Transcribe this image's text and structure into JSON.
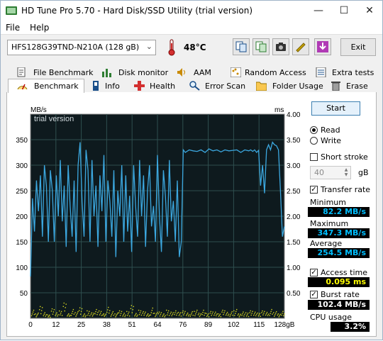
{
  "window": {
    "title": "HD Tune Pro 5.70 - Hard Disk/SSD Utility (trial version)"
  },
  "menu": {
    "file": "File",
    "help": "Help"
  },
  "toolbar": {
    "drive": "HFS128G39TND-N210A (128 gB)",
    "temperature": "48°C",
    "exit_label": "Exit"
  },
  "tabs_top": [
    "File Benchmark",
    "Disk monitor",
    "AAM",
    "Random Access",
    "Extra tests"
  ],
  "tabs_bottom": [
    "Benchmark",
    "Info",
    "Health",
    "Error Scan",
    "Folder Usage",
    "Erase"
  ],
  "active_tab": "Benchmark",
  "controls": {
    "start_label": "Start",
    "read_label": "Read",
    "write_label": "Write",
    "mode": "Read",
    "short_stroke_label": "Short stroke",
    "short_stroke_checked": false,
    "short_stroke_value": "40",
    "short_stroke_unit": "gB",
    "transfer_rate_label": "Transfer rate",
    "transfer_rate_checked": true,
    "access_time_label": "Access time",
    "access_time_checked": true,
    "burst_rate_label": "Burst rate",
    "burst_rate_checked": true
  },
  "stats": {
    "minimum_label": "Minimum",
    "minimum": "82.2 MB/s",
    "maximum_label": "Maximum",
    "maximum": "347.3 MB/s",
    "average_label": "Average",
    "average": "254.5 MB/s",
    "access_time": "0.095 ms",
    "burst_rate": "102.4 MB/s",
    "cpu_label": "CPU usage",
    "cpu": "3.2%"
  },
  "colors": {
    "plot_bg": "#0e1a1e",
    "grid": "#2f4f4f",
    "transfer_line": "#3ca8e0",
    "access_dots": "#d8d820"
  },
  "chart_data": {
    "type": "line",
    "watermark": "trial version",
    "ylabel_left": "MB/s",
    "ylabel_right": "ms",
    "xlabel": "gB",
    "xlim": [
      0,
      128
    ],
    "ylim_left": [
      0,
      400
    ],
    "ylim_right": [
      0,
      4.0
    ],
    "x_ticks": [
      "0",
      "12",
      "25",
      "38",
      "51",
      "64",
      "76",
      "89",
      "102",
      "115",
      "128gB"
    ],
    "y_ticks_left": [
      "50",
      "100",
      "150",
      "200",
      "250",
      "300",
      "350"
    ],
    "y_ticks_right": [
      "0.50",
      "1.00",
      "1.50",
      "2.00",
      "2.50",
      "3.00",
      "3.50",
      "4.00"
    ],
    "grid": true,
    "series": [
      {
        "name": "Transfer rate",
        "x": [
          0,
          1,
          2,
          3,
          4,
          5,
          6,
          7,
          8,
          9,
          10,
          11,
          12,
          13,
          14,
          15,
          16,
          17,
          18,
          19,
          20,
          21,
          22,
          23,
          24,
          25,
          26,
          27,
          28,
          29,
          30,
          31,
          32,
          33,
          34,
          35,
          36,
          37,
          38,
          39,
          40,
          41,
          42,
          43,
          44,
          45,
          46,
          47,
          48,
          49,
          50,
          51,
          52,
          53,
          54,
          55,
          56,
          57,
          58,
          59,
          60,
          61,
          62,
          63,
          64,
          65,
          66,
          67,
          68,
          69,
          70,
          71,
          72,
          73,
          74,
          75,
          76,
          77,
          78,
          80,
          82,
          84,
          86,
          88,
          90,
          92,
          94,
          96,
          98,
          100,
          102,
          104,
          106,
          108,
          110,
          111,
          112,
          113,
          114,
          115,
          116,
          117,
          118,
          119,
          120,
          121,
          122,
          123,
          124,
          125,
          126,
          127,
          128
        ],
        "values": [
          82,
          235,
          170,
          270,
          210,
          280,
          160,
          300,
          260,
          150,
          290,
          250,
          150,
          280,
          200,
          310,
          190,
          260,
          140,
          300,
          220,
          160,
          270,
          130,
          300,
          345,
          230,
          160,
          330,
          290,
          150,
          310,
          200,
          260,
          140,
          280,
          210,
          320,
          150,
          270,
          230,
          160,
          290,
          120,
          250,
          200,
          300,
          150,
          280,
          170,
          240,
          130,
          300,
          220,
          160,
          310,
          200,
          280,
          140,
          250,
          300,
          180,
          220,
          150,
          320,
          200,
          130,
          290,
          240,
          160,
          310,
          190,
          230,
          150,
          270,
          120,
          150,
          330,
          325,
          330,
          328,
          327,
          330,
          325,
          332,
          328,
          330,
          326,
          330,
          328,
          329,
          330,
          325,
          330,
          328,
          330,
          327,
          330,
          325,
          329,
          260,
          300,
          245,
          330,
          340,
          330,
          345,
          340,
          338,
          330,
          250,
          160,
          180
        ]
      }
    ],
    "access_time_ms": {
      "x": [
        1,
        3,
        5,
        7,
        9,
        11,
        13,
        15,
        17,
        19,
        21,
        23,
        25,
        27,
        29,
        31,
        33,
        35,
        37,
        39,
        41,
        43,
        45,
        47,
        49,
        51,
        53,
        55,
        57,
        59,
        61,
        63,
        65,
        67,
        69,
        71,
        73,
        75,
        77,
        79,
        81,
        83,
        85,
        87,
        89,
        91,
        93,
        95,
        97,
        99,
        101,
        103,
        105,
        107,
        109,
        111,
        113,
        115,
        117,
        119,
        121,
        123,
        125,
        127
      ],
      "values": [
        0.12,
        0.08,
        0.2,
        0.1,
        0.06,
        0.15,
        0.09,
        0.11,
        0.22,
        0.07,
        0.13,
        0.1,
        0.18,
        0.08,
        0.12,
        0.09,
        0.14,
        0.11,
        0.07,
        0.16,
        0.1,
        0.08,
        0.13,
        0.09,
        0.11,
        0.2,
        0.08,
        0.12,
        0.1,
        0.07,
        0.15,
        0.09,
        0.11,
        0.08,
        0.13,
        0.1,
        0.12,
        0.09,
        0.11,
        0.08,
        0.1,
        0.12,
        0.09,
        0.14,
        0.08,
        0.11,
        0.1,
        0.07,
        0.12,
        0.09,
        0.1,
        0.13,
        0.08,
        0.11,
        0.09,
        0.12,
        0.1,
        0.08,
        0.11,
        0.09,
        0.13,
        0.1,
        0.08,
        0.12
      ]
    }
  }
}
